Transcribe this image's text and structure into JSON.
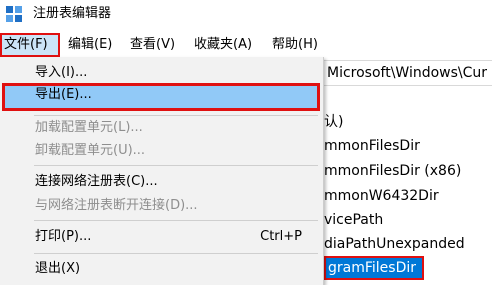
{
  "window": {
    "title": "注册表编辑器"
  },
  "menubar": {
    "items": [
      "文件(F)",
      "编辑(E)",
      "查看(V)",
      "收藏夹(A)",
      "帮助(H)"
    ]
  },
  "address": {
    "value": "Microsoft\\Windows\\Cur"
  },
  "values_list": {
    "items": [
      "认)",
      "mmonFilesDir",
      "mmonFilesDir (x86)",
      "mmonW6432Dir",
      "vicePath",
      "diaPathUnexpanded",
      "gramFilesDir"
    ]
  },
  "file_menu": {
    "import": "导入(I)...",
    "export": "导出(E)...",
    "load_hive": "加载配置单元(L)...",
    "unload_hive": "卸载配置单元(U)...",
    "connect": "连接网络注册表(C)...",
    "disconnect": "与网络注册表断开连接(D)...",
    "print": "打印(P)...",
    "print_shortcut": "Ctrl+P",
    "exit": "退出(X)"
  },
  "colors": {
    "highlight_border": "#e01010",
    "menu_hover": "#91c9f7",
    "selection": "#0078d7",
    "menu_background": "#f2f2f2"
  },
  "icons": {
    "app": "registry-cubes-icon"
  }
}
